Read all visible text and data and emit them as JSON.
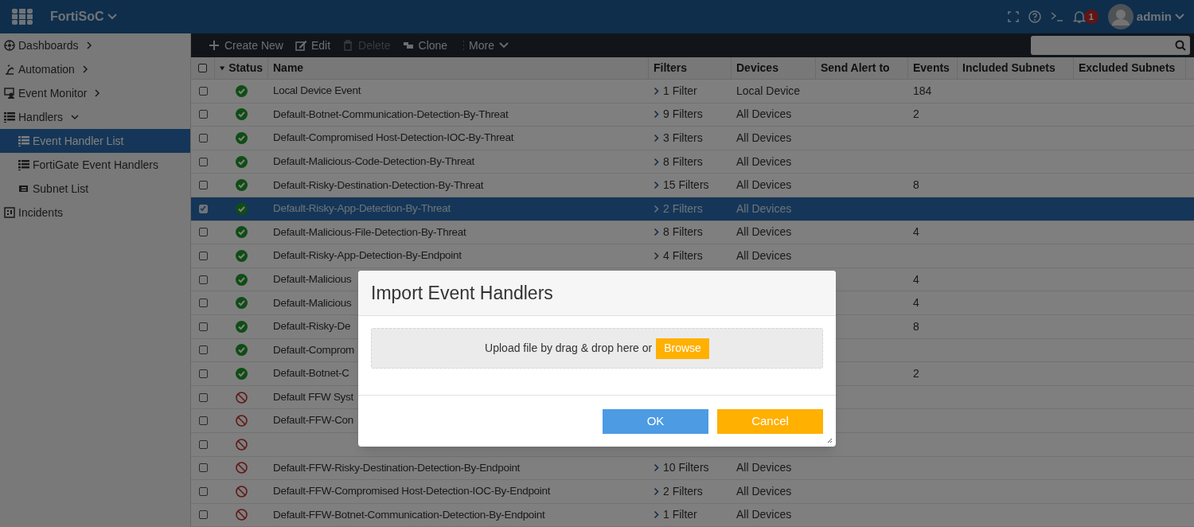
{
  "topbar": {
    "app_name": "FortiSoC",
    "notification_count": "1",
    "user": "admin"
  },
  "sidebar": {
    "items": [
      {
        "label": "Dashboards",
        "expanded": false,
        "selected": false
      },
      {
        "label": "Automation",
        "expanded": false,
        "selected": false
      },
      {
        "label": "Event Monitor",
        "expanded": false,
        "selected": false
      },
      {
        "label": "Handlers",
        "expanded": true,
        "selected": false,
        "children": [
          {
            "label": "Event Handler List",
            "selected": true
          },
          {
            "label": "FortiGate Event Handlers",
            "selected": false
          },
          {
            "label": "Subnet List",
            "selected": false
          }
        ]
      },
      {
        "label": "Incidents",
        "selected": false
      }
    ]
  },
  "toolbar": [
    {
      "label": "Create New",
      "disabled": false
    },
    {
      "label": "Edit",
      "disabled": false
    },
    {
      "label": "Delete",
      "disabled": true
    },
    {
      "label": "Clone",
      "disabled": false
    },
    {
      "label": "More",
      "disabled": false
    }
  ],
  "table": {
    "all_selected": false,
    "columns": [
      "Status",
      "Name",
      "Filters",
      "Devices",
      "Send Alert to",
      "Events",
      "Included Subnets",
      "Excluded Subnets"
    ],
    "rows": [
      {
        "selected": false,
        "enabled": true,
        "name": "Local Device Event",
        "filters": "1 Filter",
        "devices": "Local Device",
        "events": "184"
      },
      {
        "selected": false,
        "enabled": true,
        "name": "Default-Botnet-Communication-Detection-By-Threat",
        "filters": "9 Filters",
        "devices": "All Devices",
        "events": "2"
      },
      {
        "selected": false,
        "enabled": true,
        "name": "Default-Compromised Host-Detection-IOC-By-Threat",
        "filters": "3 Filters",
        "devices": "All Devices"
      },
      {
        "selected": false,
        "enabled": true,
        "name": "Default-Malicious-Code-Detection-By-Threat",
        "filters": "8 Filters",
        "devices": "All Devices"
      },
      {
        "selected": false,
        "enabled": true,
        "name": "Default-Risky-Destination-Detection-By-Threat",
        "filters": "15 Filters",
        "devices": "All Devices",
        "events": "8"
      },
      {
        "selected": true,
        "enabled": true,
        "name": "Default-Risky-App-Detection-By-Threat",
        "filters": "2 Filters",
        "devices": "All Devices"
      },
      {
        "selected": false,
        "enabled": true,
        "name": "Default-Malicious-File-Detection-By-Threat",
        "filters": "8 Filters",
        "devices": "All Devices",
        "events": "4"
      },
      {
        "selected": false,
        "enabled": true,
        "name": "Default-Risky-App-Detection-By-Endpoint",
        "filters": "4 Filters",
        "devices": "All Devices"
      },
      {
        "selected": false,
        "enabled": true,
        "name": "Default-Malicious",
        "events": "4"
      },
      {
        "selected": false,
        "enabled": true,
        "name": "Default-Malicious",
        "events": "4"
      },
      {
        "selected": false,
        "enabled": true,
        "name": "Default-Risky-De",
        "events": "8"
      },
      {
        "selected": false,
        "enabled": true,
        "name": "Default-Comprom"
      },
      {
        "selected": false,
        "enabled": true,
        "name": "Default-Botnet-C",
        "events": "2"
      },
      {
        "selected": false,
        "enabled": false,
        "name": "Default FFW Syst"
      },
      {
        "selected": false,
        "enabled": false,
        "name": "Default-FFW-Con"
      },
      {
        "selected": false,
        "enabled": false
      },
      {
        "selected": false,
        "enabled": false,
        "name": "Default-FFW-Risky-Destination-Detection-By-Endpoint",
        "filters": "10 Filters",
        "devices": "All Devices"
      },
      {
        "selected": false,
        "enabled": false,
        "name": "Default-FFW-Compromised Host-Detection-IOC-By-Endpoint",
        "filters": "2 Filters",
        "devices": "All Devices"
      },
      {
        "selected": false,
        "enabled": false,
        "name": "Default-FFW-Botnet-Communication-Detection-By-Endpoint",
        "filters": "1 Filter",
        "devices": "All Devices"
      }
    ]
  },
  "dialog": {
    "title": "Import Event Handlers",
    "dropzone_text": "Upload file by drag & drop here or",
    "browse": "Browse",
    "buttons": [
      {
        "label": "OK",
        "kind": "primary"
      },
      {
        "label": "Cancel",
        "kind": "warning"
      }
    ]
  }
}
